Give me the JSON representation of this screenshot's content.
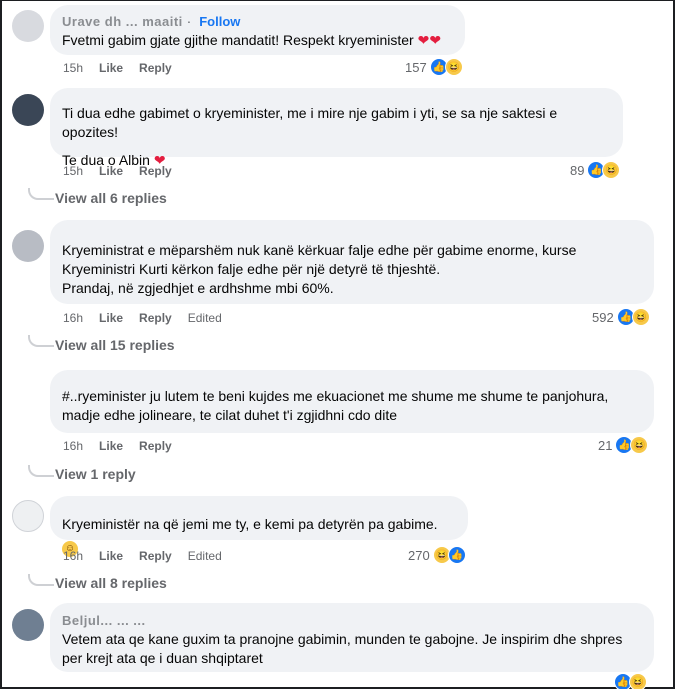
{
  "comments": [
    {
      "author": "Urave dh ... maaiti",
      "follow_label": "Follow",
      "text": "Fvetmi gabim gjate gjithe mandatit! Respekt kryeminister",
      "emoji": "❤❤",
      "time": "15h",
      "like": "Like",
      "reply": "Reply",
      "reaction_count": "157"
    },
    {
      "text": "Ti dua edhe gabimet o kryeminister, me i mire nje gabim i yti, se sa nje saktesi e opozites!",
      "text2": "Te dua o Albin",
      "emoji": "❤",
      "time": "15h",
      "like": "Like",
      "reply": "Reply",
      "reaction_count": "89",
      "view_replies": "View all 6 replies"
    },
    {
      "text": "Kryeministrat e mëparshëm nuk kanë kërkuar falje edhe për gabime enorme, kurse",
      "text2": "Kryeministri Kurti kërkon falje edhe për një detyrë të thjeshtë.",
      "text3": "Prandaj, në zgjedhjet e ardhshme mbi 60%.",
      "time": "16h",
      "like": "Like",
      "reply": "Reply",
      "edited": "Edited",
      "reaction_count": "592",
      "view_replies": "View all 15 replies"
    },
    {
      "text": "#..ryeminister ju lutem te beni kujdes me ekuacionet me shume me shume te panjohura,",
      "text2": "madje edhe jolineare, te cilat duhet t'i zgjidhni cdo dite",
      "time": "16h",
      "like": "Like",
      "reply": "Reply",
      "reaction_count": "21",
      "view_replies": "View 1 reply"
    },
    {
      "text": "Kryeministër na që jemi me ty, e kemi pa detyrën pa gabime.",
      "time": "16h",
      "like": "Like",
      "reply": "Reply",
      "edited": "Edited",
      "reaction_count": "270",
      "view_replies": "View all 8 replies"
    },
    {
      "author": "Beljul... ... ...",
      "text": "Vetem ata qe kane guxim ta pranojne gabimin, munden te gabojne. Je inspirim dhe shpres",
      "text2": "per krejt ata qe i duan shqiptaret"
    }
  ],
  "icons": {
    "like": "thumbs-up-icon",
    "haha": "haha-emoji-icon"
  },
  "colors": {
    "accent": "#1877f2",
    "bubble": "#f0f2f5",
    "meta": "#65676b"
  }
}
